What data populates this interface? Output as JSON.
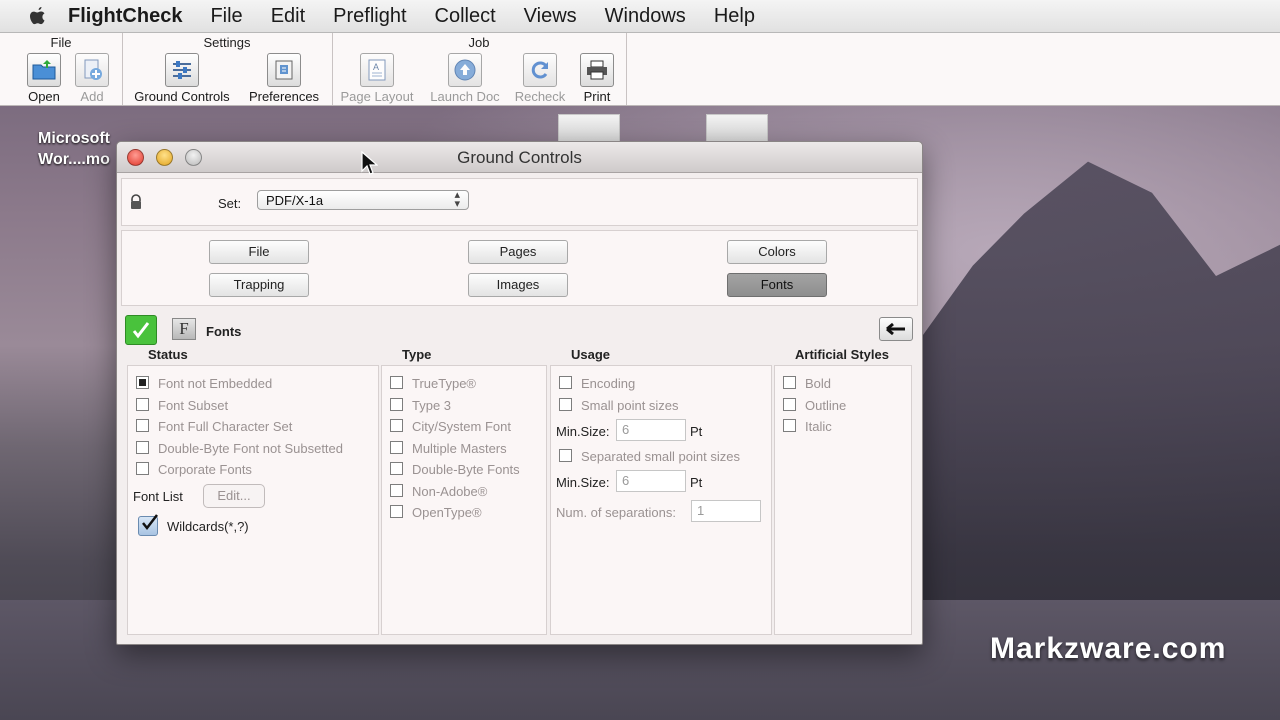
{
  "menubar": {
    "apple_icon": "apple-logo-icon",
    "items": [
      "FlightCheck",
      "File",
      "Edit",
      "Preflight",
      "Collect",
      "Views",
      "Windows",
      "Help"
    ]
  },
  "toolbar": {
    "groups": [
      {
        "title": "File",
        "buttons": [
          {
            "label": "Open",
            "icon": "open-folder-icon",
            "enabled": true
          },
          {
            "label": "Add",
            "icon": "add-document-icon",
            "enabled": false
          }
        ]
      },
      {
        "title": "Settings",
        "buttons": [
          {
            "label": "Ground Controls",
            "icon": "sliders-icon",
            "enabled": true
          },
          {
            "label": "Preferences",
            "icon": "preferences-icon",
            "enabled": true
          }
        ]
      },
      {
        "title": "Job",
        "buttons": [
          {
            "label": "Page Layout",
            "icon": "page-layout-icon",
            "enabled": false
          },
          {
            "label": "Launch Doc",
            "icon": "launch-doc-icon",
            "enabled": false
          },
          {
            "label": "Recheck",
            "icon": "recheck-icon",
            "enabled": false
          },
          {
            "label": "Print",
            "icon": "printer-icon",
            "enabled": true
          }
        ]
      }
    ]
  },
  "desktop": {
    "item_label_line1": "Microsoft",
    "item_label_line2": "Wor....mo",
    "watermark": "Markzware.com"
  },
  "window": {
    "title": "Ground Controls",
    "set_label": "Set:",
    "set_value": "PDF/X-1a",
    "categories": [
      "File",
      "Pages",
      "Colors",
      "Trapping",
      "Images",
      "Fonts"
    ],
    "selected_category": "Fonts",
    "section_title": "Fonts",
    "columns": {
      "status": {
        "header": "Status",
        "options": [
          {
            "label": "Font not Embedded",
            "state": "mixed"
          },
          {
            "label": "Font Subset",
            "state": "off"
          },
          {
            "label": "Font Full Character Set",
            "state": "off"
          },
          {
            "label": "Double-Byte Font not Subsetted",
            "state": "off"
          },
          {
            "label": "Corporate Fonts",
            "state": "off"
          }
        ],
        "font_list_label": "Font List",
        "edit_button": "Edit...",
        "wildcards_label": "Wildcards(*,?)",
        "wildcards_checked": true
      },
      "type": {
        "header": "Type",
        "options": [
          "TrueType®",
          "Type 3",
          "City/System Font",
          "Multiple Masters",
          "Double-Byte Fonts",
          "Non-Adobe®",
          "OpenType®"
        ]
      },
      "usage": {
        "header": "Usage",
        "encoding": "Encoding",
        "small_point_sizes": "Small point sizes",
        "min_size_label": "Min.Size:",
        "min_size_1": "6",
        "pt_label": "Pt",
        "separated_small": "Separated small point sizes",
        "min_size_2": "6",
        "num_separations_label": "Num. of separations:",
        "num_separations": "1"
      },
      "artificial": {
        "header": "Artificial Styles",
        "options": [
          "Bold",
          "Outline",
          "Italic"
        ]
      }
    }
  }
}
